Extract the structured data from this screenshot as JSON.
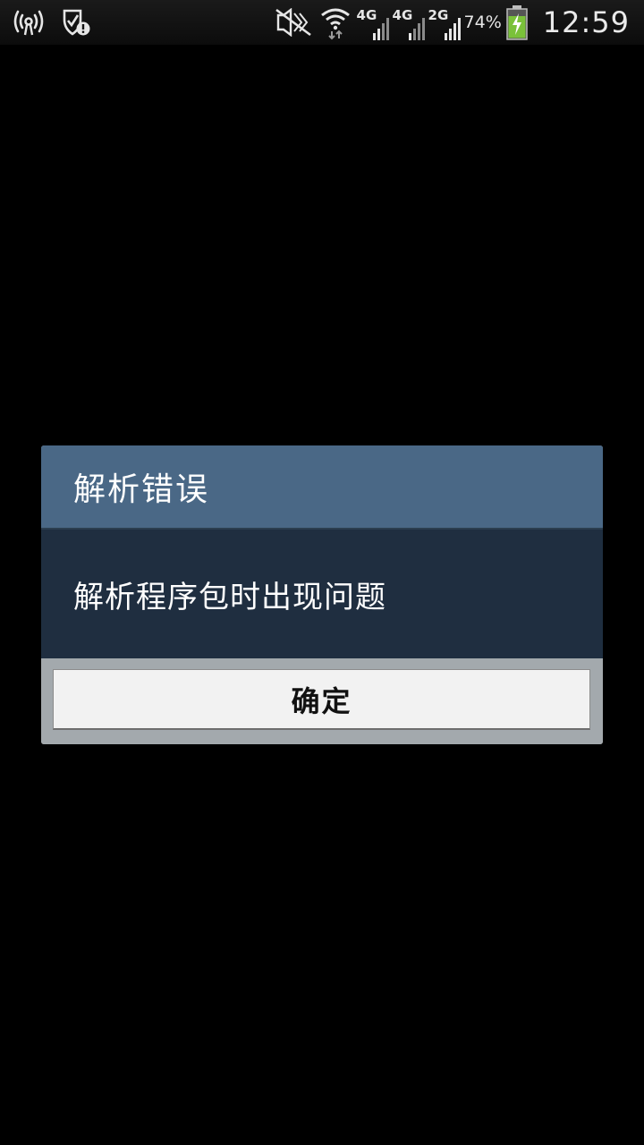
{
  "status_bar": {
    "left_icons": [
      "hotspot-icon",
      "shield-alert-icon"
    ],
    "right_icons": [
      "no-sim-icon",
      "wifi-icon"
    ],
    "networks": [
      {
        "label": "4G",
        "icon": "signal-bars-icon"
      },
      {
        "label": "4G",
        "icon": "signal-bars-icon"
      },
      {
        "label": "2G",
        "icon": "signal-bars-icon"
      }
    ],
    "battery_percent": "74%",
    "battery_level": 0.74,
    "battery_color": "#7ac13a",
    "time": "12:59"
  },
  "dialog": {
    "title": "解析错误",
    "message": "解析程序包时出现问题",
    "ok_label": "确定",
    "colors": {
      "title_bg": "#4a6886",
      "body_bg": "#1f2e40",
      "footer_bg": "#a3a9ad",
      "button_bg": "#f2f2f2"
    }
  }
}
